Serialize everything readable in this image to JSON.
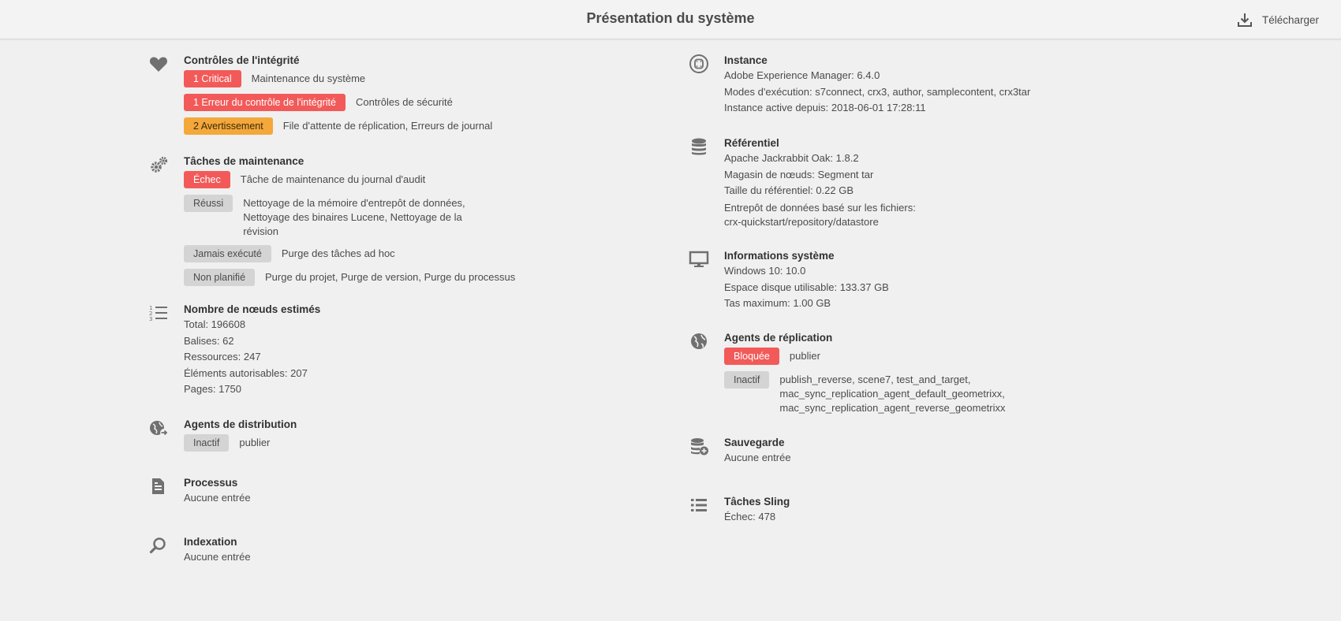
{
  "header": {
    "title": "Présentation du système",
    "download_label": "Télécharger"
  },
  "left": {
    "health": {
      "title": "Contrôles de l'intégrité",
      "rows": [
        {
          "badge": "1 Critical",
          "text": "Maintenance du système",
          "color": "#f25a59"
        },
        {
          "badge": "1 Erreur du contrôle de l'intégrité",
          "text": "Contrôles de sécurité",
          "color": "#f25a59"
        },
        {
          "badge": "2 Avertissement",
          "text": "File d'attente de réplication, Erreurs de journal",
          "color": "#f4a83b"
        }
      ]
    },
    "maintenance": {
      "title": "Tâches de maintenance",
      "rows": [
        {
          "badge": "Échec",
          "text": "Tâche de maintenance du journal d'audit"
        },
        {
          "badge": "Réussi",
          "text": "Nettoyage de la mémoire d'entrepôt de données, Nettoyage des binaires Lucene, Nettoyage de la révision"
        },
        {
          "badge": "Jamais exécuté",
          "text": "Purge des tâches ad hoc"
        },
        {
          "badge": "Non planifié",
          "text": "Purge du projet, Purge de version, Purge du processus"
        }
      ]
    },
    "nodes": {
      "title": "Nombre de nœuds estimés",
      "lines": [
        "Total: 196608",
        "Balises: 62",
        "Ressources: 247",
        "Éléments autorisables: 207",
        "Pages: 1750"
      ]
    },
    "distribution": {
      "title": "Agents de distribution",
      "badge": "Inactif",
      "text": "publier"
    },
    "workflows": {
      "title": "Processus",
      "text": "Aucune entrée"
    },
    "indexing": {
      "title": "Indexation",
      "text": "Aucune entrée"
    }
  },
  "right": {
    "instance": {
      "title": "Instance",
      "lines": [
        "Adobe Experience Manager: 6.4.0",
        "Modes d'exécution: s7connect, crx3, author, samplecontent, crx3tar",
        "Instance active depuis: 2018-06-01 17:28:11"
      ]
    },
    "repository": {
      "title": "Référentiel",
      "lines": [
        "Apache Jackrabbit Oak: 1.8.2",
        "Magasin de nœuds: Segment tar",
        "Taille du référentiel: 0.22 GB",
        "Entrepôt de données basé sur les fichiers: crx-quickstart/repository/datastore"
      ]
    },
    "system": {
      "title": "Informations système",
      "lines": [
        "Windows 10: 10.0",
        "Espace disque utilisable: 133.37 GB",
        "Tas maximum: 1.00 GB"
      ]
    },
    "replication": {
      "title": "Agents de réplication",
      "rows": [
        {
          "badge": "Bloquée",
          "text": "publier"
        },
        {
          "badge": "Inactif",
          "text": "publish_reverse, scene7, test_and_target, mac_sync_replication_agent_default_geometrixx, mac_sync_replication_agent_reverse_geometrixx"
        }
      ]
    },
    "backup": {
      "title": "Sauvegarde",
      "text": "Aucune entrée"
    },
    "sling": {
      "title": "Tâches Sling",
      "text": "Échec: 478"
    }
  },
  "icons": {
    "download": "download-icon",
    "health": "heart-icon",
    "maintenance": "gears-icon",
    "nodes": "numbered-list-icon",
    "distribution": "globe-arrow-icon",
    "workflows": "document-icon",
    "indexing": "search-icon",
    "instance": "server-icon",
    "repository": "database-icon",
    "system": "monitor-icon",
    "replication": "globe-icon",
    "backup": "database-add-icon",
    "sling": "list-icon"
  },
  "colors": {
    "critical": "#f25a59",
    "warning": "#f4a83b",
    "neutral": "#d4d4d4"
  }
}
